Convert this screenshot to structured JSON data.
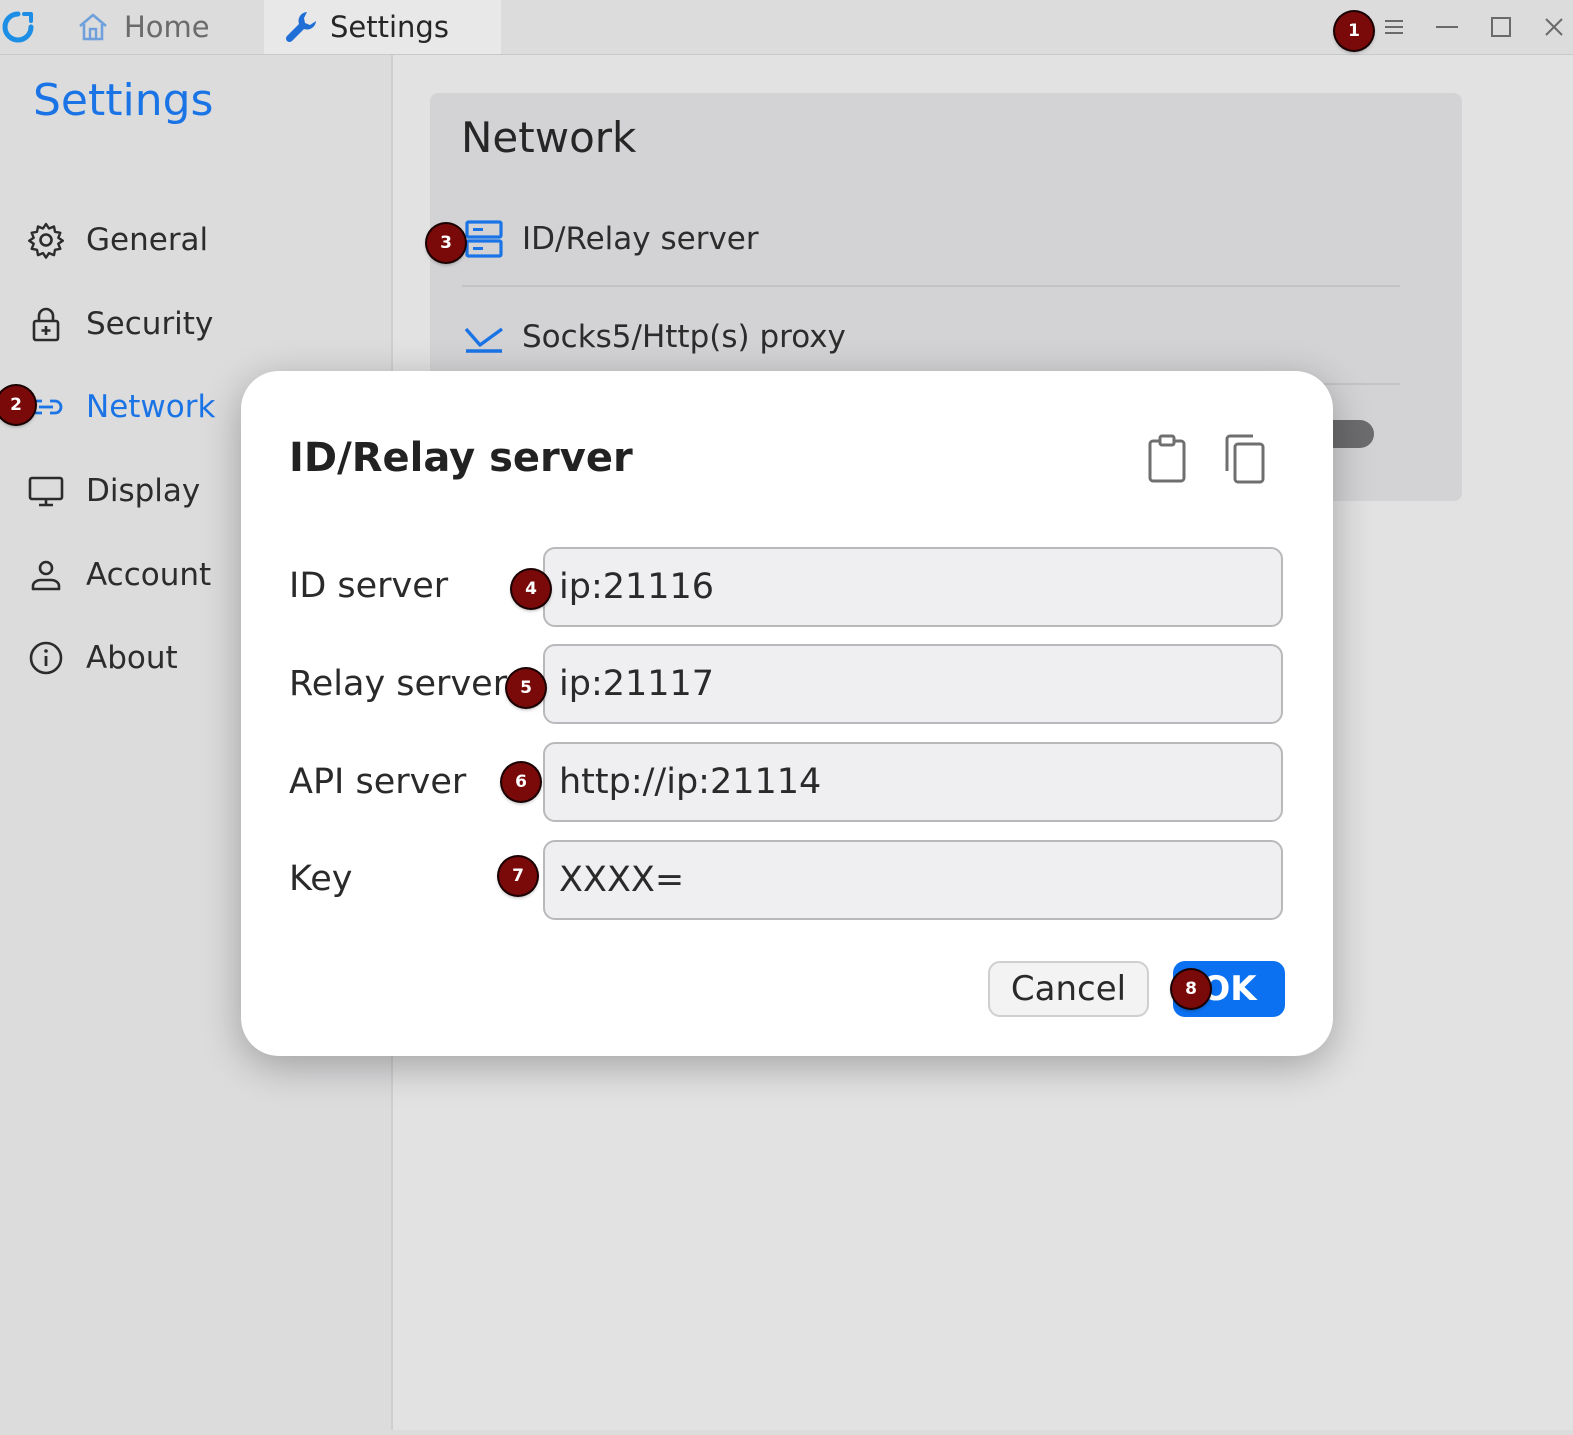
{
  "titlebar": {
    "tabs": [
      {
        "label": "Home",
        "icon": "home-icon"
      },
      {
        "label": "Settings",
        "icon": "wrench-icon"
      }
    ],
    "window_controls": [
      "menu-icon",
      "minimize-icon",
      "maximize-icon",
      "close-icon"
    ]
  },
  "sidebar": {
    "title": "Settings",
    "items": [
      {
        "label": "General",
        "icon": "gear-icon"
      },
      {
        "label": "Security",
        "icon": "lock-icon"
      },
      {
        "label": "Network",
        "icon": "link-icon",
        "active": true
      },
      {
        "label": "Display",
        "icon": "monitor-icon"
      },
      {
        "label": "Account",
        "icon": "person-icon"
      },
      {
        "label": "About",
        "icon": "info-icon"
      }
    ]
  },
  "network_card": {
    "title": "Network",
    "rows": [
      {
        "label": "ID/Relay server",
        "icon": "server-icon"
      },
      {
        "label": "Socks5/Http(s) proxy",
        "icon": "proxy-icon"
      }
    ]
  },
  "dialog": {
    "title": "ID/Relay server",
    "fields": [
      {
        "label": "ID server",
        "value": "ip:21116"
      },
      {
        "label": "Relay server",
        "value": "ip:21117"
      },
      {
        "label": "API server",
        "value": "http://ip:21114"
      },
      {
        "label": "Key",
        "value": "XXXX="
      }
    ],
    "cancel_label": "Cancel",
    "ok_label": "OK"
  },
  "markers": [
    "1",
    "2",
    "3",
    "4",
    "5",
    "6",
    "7",
    "8"
  ],
  "colors": {
    "accent": "#1a74e6",
    "ok_button": "#0b71f0",
    "marker": "#7a0a0a",
    "background": "#dcdcdd"
  }
}
